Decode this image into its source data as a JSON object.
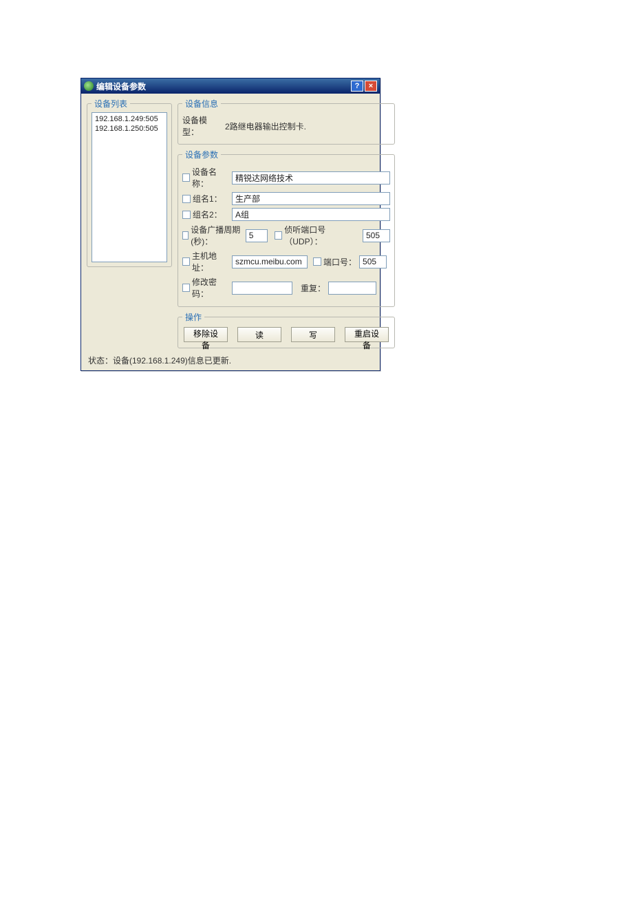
{
  "window": {
    "title": "编辑设备参数"
  },
  "sidebar": {
    "legend": "设备列表",
    "items": [
      {
        "label": "192.168.1.249:505"
      },
      {
        "label": "192.168.1.250:505"
      }
    ]
  },
  "info": {
    "legend": "设备信息",
    "model_label": "设备模型：",
    "model_value": "2路继电器输出控制卡."
  },
  "params": {
    "legend": "设备参数",
    "name_check": "设备名称：",
    "name_value": "精锐达网络技术",
    "group1_check": "组名1：",
    "group1_value": "生产部",
    "group2_check": "组名2：",
    "group2_value": "A组",
    "broadcast_check": "设备广播周期(秒)：",
    "broadcast_value": "5",
    "listen_port_check": "侦听端口号（UDP）：",
    "listen_port_value": "505",
    "host_check": "主机地址：",
    "host_value": "szmcu.meibu.com",
    "port_check": "端口号：",
    "port_value": "505",
    "modify_pwd_check": "修改密码：",
    "repeat_label": "重复："
  },
  "ops": {
    "legend": "操作",
    "remove": "移除设备",
    "read": "读",
    "write": "写",
    "restart": "重启设备"
  },
  "status": {
    "text": "状态：设备(192.168.1.249)信息已更新."
  }
}
